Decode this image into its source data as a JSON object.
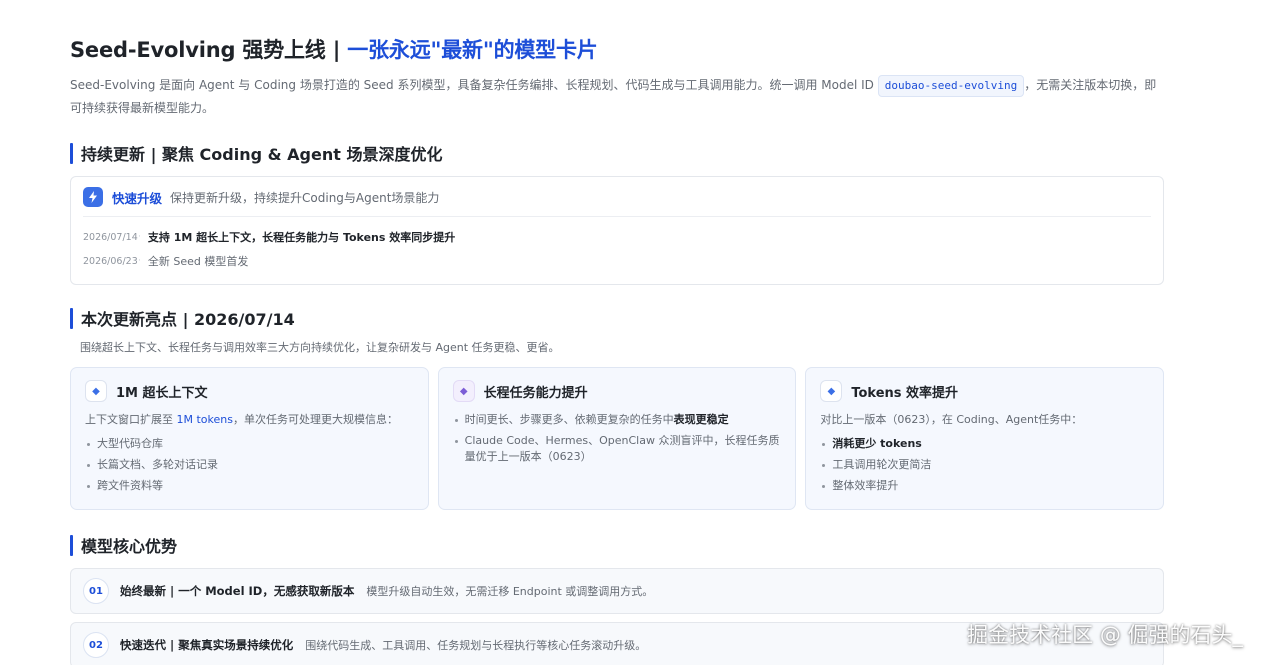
{
  "header": {
    "title_main": "Seed-Evolving 强势上线 | ",
    "title_accent": "一张永远\"最新\"的模型卡片",
    "intro_before": "Seed-Evolving 是面向 Agent 与 Coding 场景打造的 Seed 系列模型，具备复杂任务编排、长程规划、代码生成与工具调用能力。统一调用 Model ID ",
    "model_id": "doubao-seed-evolving",
    "intro_after": "，无需关注版本切换，即可持续获得最新模型能力。"
  },
  "updates_section": {
    "heading": "持续更新 | 聚焦 Coding & Agent 场景深度优化",
    "card_title": "快速升级",
    "card_desc": "保持更新升级，持续提升Coding与Agent场景能力",
    "log": [
      {
        "date": "2026/07/14",
        "text": "支持 1M 超长上下文，长程任务能力与 Tokens 效率同步提升"
      },
      {
        "date": "2026/06/23",
        "text": "全新 Seed 模型首发"
      }
    ]
  },
  "highlights_section": {
    "heading": "本次更新亮点 | 2026/07/14",
    "subtitle": "围绕超长上下文、长程任务与调用效率三大方向持续优化，让复杂研发与 Agent 任务更稳、更省。",
    "cards": [
      {
        "title": "1M 超长上下文",
        "desc_before": "上下文窗口扩展至 ",
        "desc_highlight": "1M tokens",
        "desc_after": "，单次任务可处理更大规模信息：",
        "items": [
          "大型代码仓库",
          "长篇文档、多轮对话记录",
          "跨文件资料等"
        ]
      },
      {
        "title": "长程任务能力提升",
        "item1_before": "时间更长、步骤更多、依赖更复杂的任务中",
        "item1_bold": "表现更稳定",
        "item2": "Claude Code、Hermes、OpenClaw 众测盲评中，长程任务质量优于上一版本（0623）"
      },
      {
        "title": "Tokens 效率提升",
        "desc": "对比上一版本（0623），在 Coding、Agent任务中：",
        "item1": "消耗更少 tokens",
        "item2": "工具调用轮次更简洁",
        "item3": "整体效率提升"
      }
    ]
  },
  "advantages_section": {
    "heading": "模型核心优势",
    "items": [
      {
        "num": "01",
        "title": "始终最新 | 一个 Model ID，无感获取新版本",
        "desc": "模型升级自动生效，无需迁移 Endpoint 或调整调用方式。"
      },
      {
        "num": "02",
        "title": "快速迭代 | 聚焦真实场景持续优化",
        "desc": "围绕代码生成、工具调用、任务规划与长程执行等核心任务滚动升级。"
      }
    ]
  },
  "watermark": "掘金技术社区 @ 倔强的石头_",
  "icons": {
    "bolt": "lightning-bolt-icon",
    "diamond": "diamond-icon"
  },
  "colors": {
    "accent": "#1d4ed8",
    "card_bg": "#f5f8fe",
    "text": "#1f2329",
    "muted": "#646a73"
  }
}
